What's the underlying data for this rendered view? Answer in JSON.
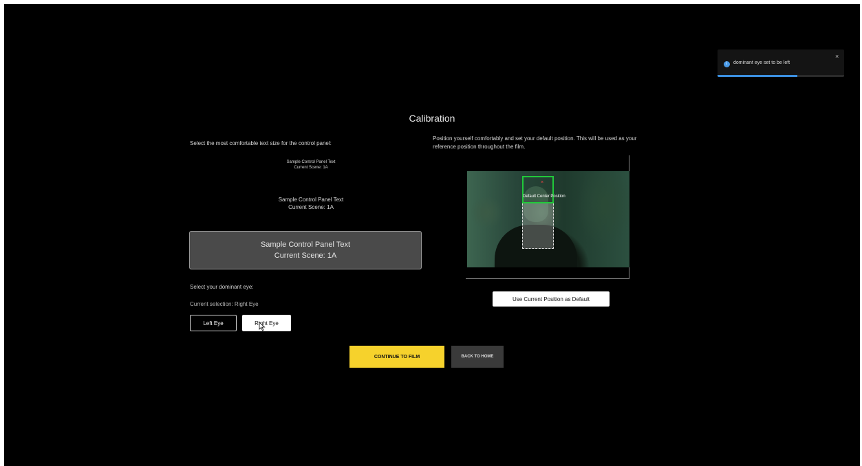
{
  "page": {
    "title": "Calibration"
  },
  "text_size": {
    "instruction": "Select the most comfortable text size for the control panel:",
    "samples": [
      {
        "line1": "Sample Control Panel Text",
        "line2": "Current Scene: 1A"
      },
      {
        "line1": "Sample Control Panel Text",
        "line2": "Current Scene: 1A"
      },
      {
        "line1": "Sample Control Panel Text",
        "line2": "Current Scene: 1A"
      }
    ]
  },
  "dominant_eye": {
    "label": "Select your dominant eye:",
    "current": "Current selection: Right Eye",
    "left_label": "Left Eye",
    "right_label": "Right Eye"
  },
  "position": {
    "instruction": "Position yourself comfortably and set your default position. This will be used as your reference position throughout the film.",
    "overlay_label": "Default Center Position",
    "marker": "×",
    "button_label": "Use Current Position as Default"
  },
  "actions": {
    "continue_label": "CONTINUE TO FILM",
    "back_label": "BACK TO HOME"
  },
  "toast": {
    "icon": "i",
    "message": "dominant eye set to be left",
    "close": "×",
    "progress_fraction": 0.63,
    "progress_color": "#3b8fe0"
  },
  "colors": {
    "background": "#000000",
    "accent_yellow": "#f6d22c",
    "tracking_green": "#21c93a"
  }
}
